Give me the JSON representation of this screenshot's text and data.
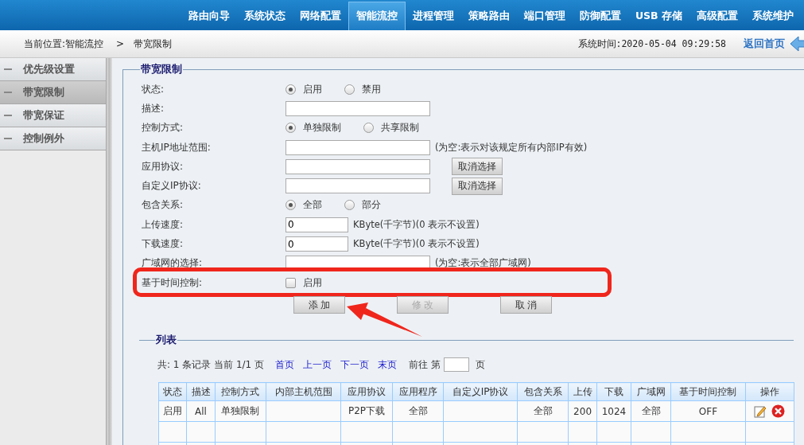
{
  "nav": [
    {
      "label": "路由向导",
      "selected": false
    },
    {
      "label": "系统状态",
      "selected": false
    },
    {
      "label": "网络配置",
      "selected": false
    },
    {
      "label": "智能流控",
      "selected": true
    },
    {
      "label": "进程管理",
      "selected": false
    },
    {
      "label": "策略路由",
      "selected": false
    },
    {
      "label": "端口管理",
      "selected": false
    },
    {
      "label": "防御配置",
      "selected": false
    },
    {
      "label": "USB 存储",
      "selected": false
    },
    {
      "label": "高级配置",
      "selected": false
    },
    {
      "label": "系统维护",
      "selected": false
    }
  ],
  "breadcrumb": {
    "location": "当前位置:智能流控",
    "separator": ">",
    "current": "带宽限制"
  },
  "system_time": "系统时间:2020-05-04 09:29:58",
  "home_link": "返回首页",
  "sidebar": {
    "items": [
      {
        "label": "优先级设置",
        "selected": false
      },
      {
        "label": "带宽限制",
        "selected": true
      },
      {
        "label": "带宽保证",
        "selected": false
      },
      {
        "label": "控制例外",
        "selected": false
      }
    ]
  },
  "form": {
    "title": "带宽限制",
    "rows": [
      {
        "kind": "radio",
        "label": "状态:",
        "options": [
          {
            "label": "启用",
            "selected": true
          },
          {
            "label": "禁用",
            "selected": false
          }
        ]
      },
      {
        "kind": "text",
        "label": "描述:"
      },
      {
        "kind": "radio",
        "label": "控制方式:",
        "options": [
          {
            "label": "单独限制",
            "selected": true
          },
          {
            "label": "共享限制",
            "selected": false
          }
        ]
      },
      {
        "kind": "text",
        "label": "主机IP地址范围:",
        "note": "(为空:表示对该规定所有内部IP有效)"
      },
      {
        "kind": "text",
        "label": "应用协议:",
        "button": "取消选择"
      },
      {
        "kind": "text",
        "label": "自定义IP协议:",
        "button": "取消选择"
      },
      {
        "kind": "radio",
        "label": "包含关系:",
        "options": [
          {
            "label": "全部",
            "selected": true
          },
          {
            "label": "部分",
            "selected": false
          }
        ]
      },
      {
        "kind": "short",
        "label": "上传速度:",
        "value": "0",
        "note": "KByte(千字节)(0 表示不设置)"
      },
      {
        "kind": "short",
        "label": "下载速度:",
        "value": "0",
        "note": "KByte(千字节)(0 表示不设置)"
      },
      {
        "kind": "text",
        "label": "广域网的选择:",
        "note": "(为空:表示全部广域网)"
      },
      {
        "kind": "checkbox",
        "label": "基于时间控制:",
        "option": "启用",
        "checked": false,
        "highlighted": true
      }
    ],
    "buttons": [
      {
        "label": "添 加",
        "disabled": false,
        "arrow": true
      },
      {
        "label": "修 改",
        "disabled": true
      },
      {
        "label": "取 消",
        "disabled": false
      }
    ]
  },
  "list": {
    "title": "列表",
    "pager": {
      "summary": "共: 1 条记录 当前 1/1 页",
      "links": [
        "首页",
        "上一页",
        "下一页",
        "末页"
      ],
      "goto_prefix": "前往 第",
      "goto_suffix": "页"
    },
    "table": {
      "columns": [
        "状态",
        "描述",
        "控制方式",
        "内部主机范围",
        "应用协议",
        "应用程序",
        "自定义IP协议",
        "包含关系",
        "上传",
        "下载",
        "广域网",
        "基于时间控制",
        "操作"
      ],
      "rows": [
        {
          "cells": [
            "启用",
            "All",
            "单独限制",
            "",
            "P2P下载",
            "全部",
            "",
            "全部",
            "200",
            "1024",
            "全部",
            "OFF"
          ],
          "actions": [
            {
              "kind": "edit"
            },
            {
              "kind": "delete"
            }
          ]
        }
      ]
    }
  }
}
